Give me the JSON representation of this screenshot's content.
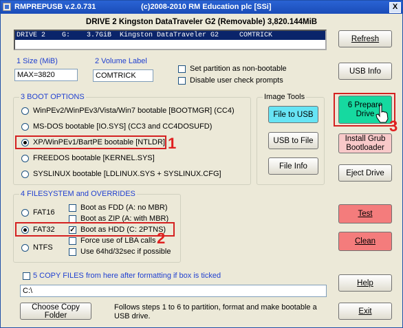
{
  "window": {
    "title": "RMPREPUSB v.2.0.731",
    "copyright": "(c)2008-2010 RM Education plc [SSi]",
    "close_label": "X"
  },
  "drive": {
    "header": "DRIVE  2 Kingston DataTraveler G2  (Removable) 3,820.144MiB",
    "list_row": "DRIVE 2    G:    3.7GiB  Kingston DataTraveler G2     COMTRICK"
  },
  "size": {
    "label": "1 Size (MiB)",
    "value": "MAX=3820"
  },
  "volume": {
    "label": "2 Volume Label",
    "value": "COMTRICK"
  },
  "options": {
    "non_bootable": "Set partition as non-bootable",
    "disable_checks": "Disable user check prompts"
  },
  "boot_options": {
    "title": "3 BOOT OPTIONS",
    "items": [
      {
        "label": "WinPEv2/WinPEv3/Vista/Win7 bootable [BOOTMGR] (CC4)",
        "selected": false
      },
      {
        "label": "MS-DOS bootable [IO.SYS]    (CC3 and CC4DOSUFD)",
        "selected": false
      },
      {
        "label": "XP/WinPEv1/BartPE bootable [NTLDR]",
        "selected": true
      },
      {
        "label": "FREEDOS bootable [KERNEL.SYS]",
        "selected": false
      },
      {
        "label": "SYSLINUX bootable [LDLINUX.SYS + SYSLINUX.CFG]",
        "selected": false
      }
    ]
  },
  "image_tools": {
    "title": "Image Tools",
    "file_to_usb": "File to USB",
    "usb_to_file": "USB to File",
    "file_info": "File Info"
  },
  "filesystem": {
    "title": "4 FILESYSTEM and OVERRIDES",
    "fs": [
      {
        "label": "FAT16",
        "selected": false
      },
      {
        "label": "FAT32",
        "selected": true
      },
      {
        "label": "NTFS",
        "selected": false
      }
    ],
    "overrides": [
      {
        "label": "Boot as FDD (A: no MBR)",
        "checked": false
      },
      {
        "label": "Boot as ZIP (A: with MBR)",
        "checked": false
      },
      {
        "label": "Boot as HDD (C: 2PTNS)",
        "checked": true
      },
      {
        "label": "Force use of LBA calls",
        "checked": false
      },
      {
        "label": "Use 64hd/32sec if possible",
        "checked": false
      }
    ]
  },
  "buttons": {
    "refresh": "Refresh",
    "usb_info": "USB Info",
    "prepare_line1": "6  Prepare",
    "prepare_line2": "Drive",
    "install_grub_line1": "Install Grub",
    "install_grub_line2": "Bootloader",
    "eject": "Eject Drive",
    "test": "Test",
    "clean": "Clean",
    "help": "Help",
    "exit": "Exit",
    "choose_copy_folder": "Choose Copy Folder"
  },
  "copy_files": {
    "label": "5 COPY FILES from here after formatting if box is ticked",
    "path": "C:\\"
  },
  "footer_text": "Follows steps 1 to 6 to partition, format and make bootable a USB drive.",
  "annotations": {
    "step1": "1",
    "step2": "2",
    "step3": "3"
  },
  "colors": {
    "accent_red": "#d42020",
    "title_blue": "#1a4cb8",
    "label_blue": "#1f3fd0",
    "test_red": "#f47c7c",
    "file_usb_cyan": "#67e4f4",
    "prepare_green": "#16d9a0"
  }
}
